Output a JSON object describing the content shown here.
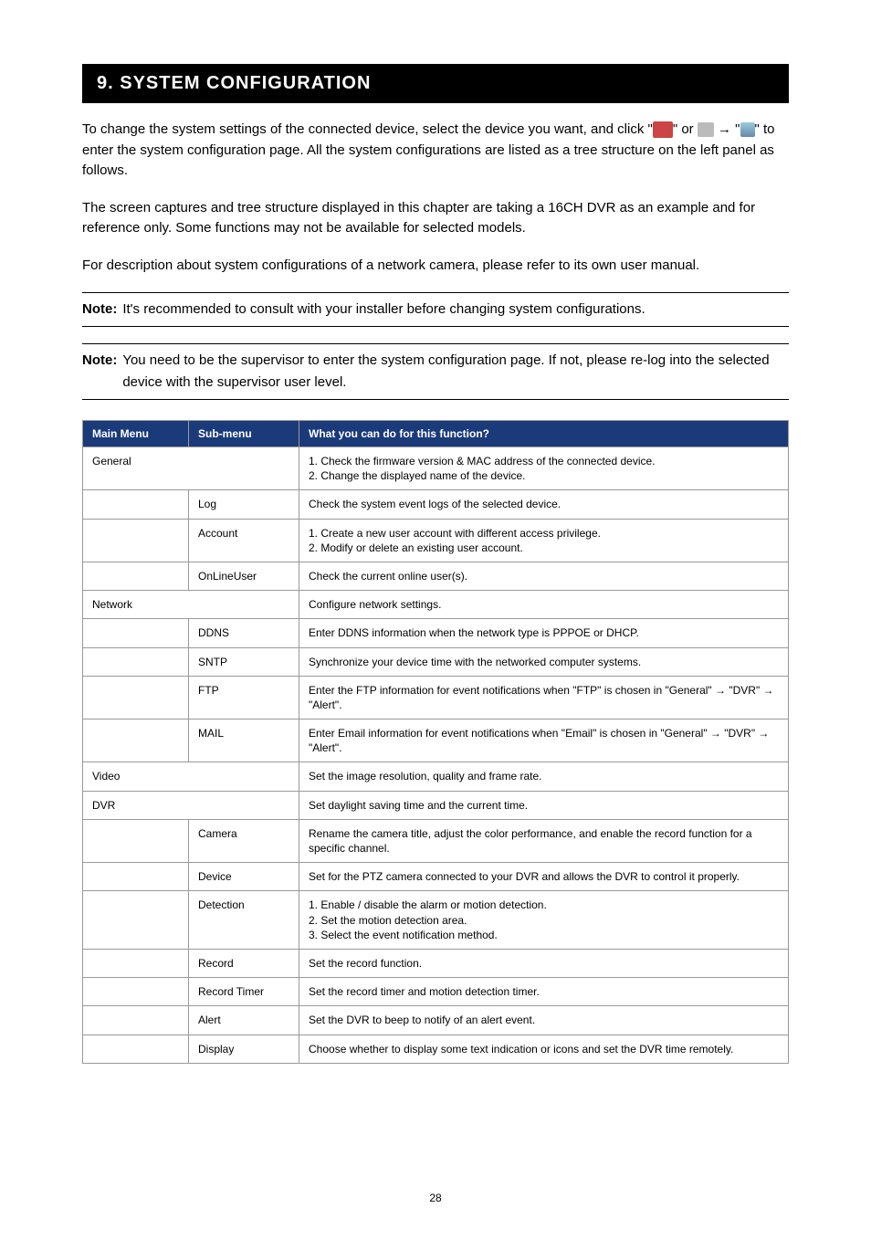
{
  "header": {
    "title": "9. SYSTEM CONFIGURATION"
  },
  "paragraphs": {
    "p1_a": "To change the system settings of the connected device, select the device you want, and click \"",
    "p1_b": "\" or ",
    "p1_c": " → \"",
    "p1_d": "\" to enter the system configuration page. All the system configurations are listed as a tree structure on the left panel as follows.",
    "p2": "The screen captures and tree structure displayed in this chapter are taking a 16CH DVR as an example and for reference only. Some functions may not be available for selected models.",
    "p3": "For description about system configurations of a network camera, please refer to its own user manual."
  },
  "notes": {
    "label": "Note:",
    "n1": "It's recommended to consult with your installer before changing system configurations.",
    "n2": "You need to be the supervisor to enter the system configuration page. If not, please re-log into the selected device with the supervisor user level."
  },
  "table": {
    "headers": {
      "main": "Main Menu",
      "sub": "Sub-menu",
      "desc": "What you can do for this function?"
    },
    "rows": [
      {
        "main": "General",
        "sub": "",
        "desc": "1. Check the firmware version & MAC address of the connected device.\n2. Change the displayed name of the device."
      },
      {
        "main": "",
        "sub": "Log",
        "desc": "Check the system event logs of the selected device."
      },
      {
        "main": "",
        "sub": "Account",
        "desc": "1. Create a new user account with different access privilege.\n2. Modify or delete an existing user account."
      },
      {
        "main": "",
        "sub": "OnLineUser",
        "desc": "Check the current online user(s)."
      },
      {
        "main": "Network",
        "sub": "",
        "desc": "Configure network settings."
      },
      {
        "main": "",
        "sub": "DDNS",
        "desc": "Enter DDNS information when the network type is PPPOE or DHCP."
      },
      {
        "main": "",
        "sub": "SNTP",
        "desc": "Synchronize your device time with the networked computer systems."
      },
      {
        "main": "",
        "sub": "FTP",
        "desc": "Enter the FTP information for event notifications when \"FTP\" is chosen in \"General\" → \"DVR\" → \"Alert\"."
      },
      {
        "main": "",
        "sub": "MAIL",
        "desc": "Enter Email information for event notifications when \"Email\" is chosen in \"General\" → \"DVR\" → \"Alert\"."
      },
      {
        "main": "Video",
        "sub": "",
        "desc": "Set the image resolution, quality and frame rate."
      },
      {
        "main": "DVR",
        "sub": "",
        "desc": "Set daylight saving time and the current time."
      },
      {
        "main": "",
        "sub": "Camera",
        "desc": "Rename the camera title, adjust the color performance, and enable the record function for a specific channel."
      },
      {
        "main": "",
        "sub": "Device",
        "desc": "Set for the PTZ camera connected to your DVR and allows the DVR to control it properly."
      },
      {
        "main": "",
        "sub": "Detection",
        "desc": "1. Enable / disable the alarm or motion detection.\n2. Set the motion detection area.\n3. Select the event notification method."
      },
      {
        "main": "",
        "sub": "Record",
        "desc": "Set the record function."
      },
      {
        "main": "",
        "sub": "Record Timer",
        "desc": "Set the record timer and motion detection timer."
      },
      {
        "main": "",
        "sub": "Alert",
        "desc": "Set the DVR to beep to notify of an alert event."
      },
      {
        "main": "",
        "sub": "Display",
        "desc": "Choose whether to display some text indication or icons and set the DVR time remotely."
      }
    ]
  },
  "pageNumber": "28"
}
